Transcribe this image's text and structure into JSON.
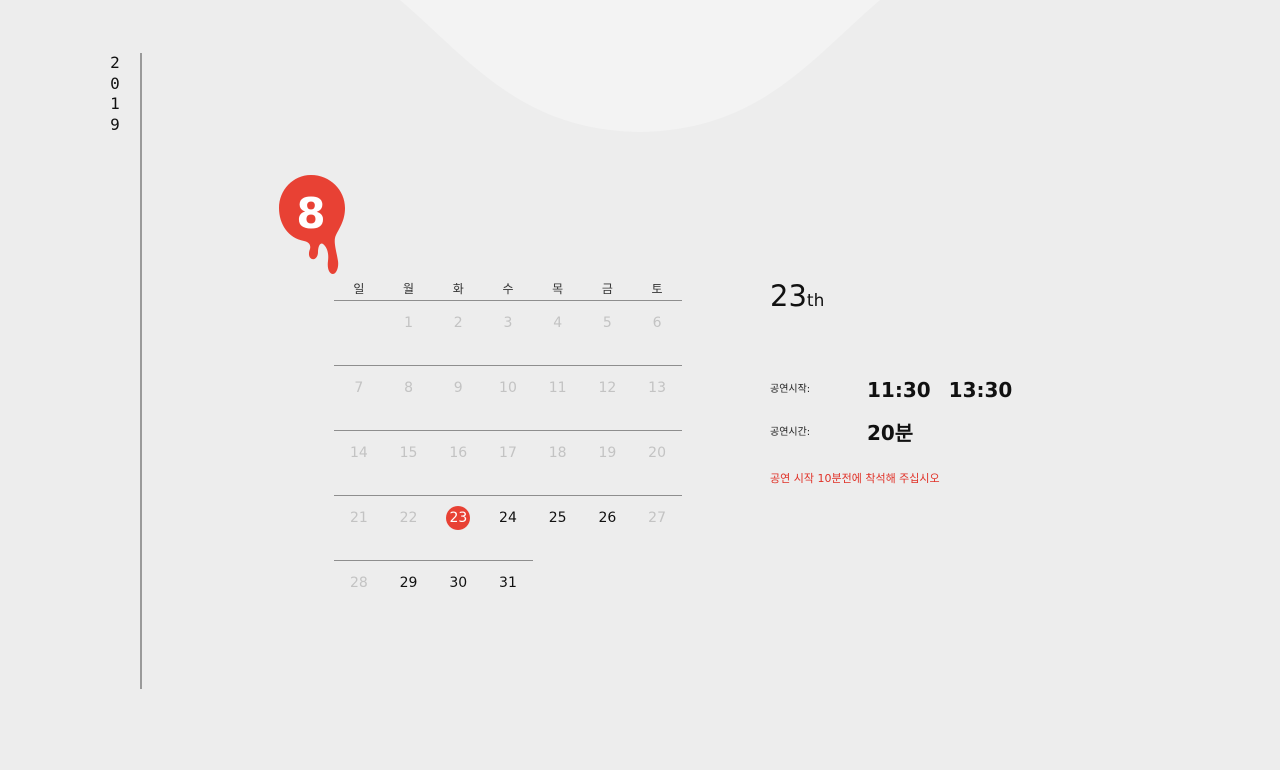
{
  "year": "2019",
  "month": {
    "number": "8",
    "badge_color": "#e84134"
  },
  "calendar": {
    "weekdays": [
      "일",
      "월",
      "화",
      "수",
      "목",
      "금",
      "토"
    ],
    "weeks": [
      [
        "",
        "1",
        "2",
        "3",
        "4",
        "5",
        "6"
      ],
      [
        "7",
        "8",
        "9",
        "10",
        "11",
        "12",
        "13"
      ],
      [
        "14",
        "15",
        "16",
        "17",
        "18",
        "19",
        "20"
      ],
      [
        "21",
        "22",
        "23",
        "24",
        "25",
        "26",
        "27"
      ],
      [
        "28",
        "29",
        "30",
        "31",
        "",
        "",
        ""
      ]
    ],
    "selected_day": "23",
    "available_days": [
      "23",
      "24",
      "25",
      "26",
      "29",
      "30",
      "31"
    ]
  },
  "info": {
    "selected_date_number": "23",
    "selected_date_suffix": "th",
    "start_label": "공연시작:",
    "start_times": [
      "11:30",
      "13:30"
    ],
    "duration_label": "공연시간:",
    "duration_value": "20분",
    "notice": "공연 시작 10분전에 착석해 주십시오"
  },
  "colors": {
    "accent": "#e84134",
    "notice": "#e03127",
    "background": "#ededed"
  }
}
